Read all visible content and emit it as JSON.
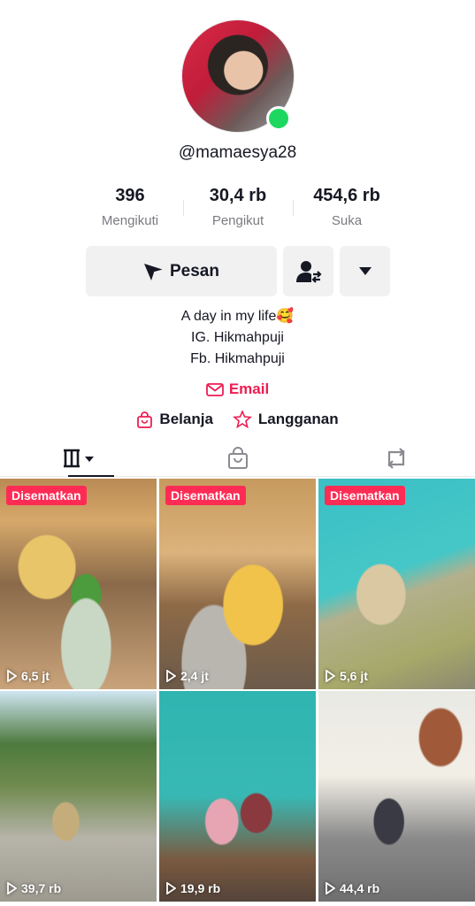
{
  "profile": {
    "username": "@mamaesya28",
    "online_color": "#1ed760"
  },
  "stats": [
    {
      "value": "396",
      "label": "Mengikuti"
    },
    {
      "value": "30,4 rb",
      "label": "Pengikut"
    },
    {
      "value": "454,6 rb",
      "label": "Suka"
    }
  ],
  "actions": {
    "message_label": "Pesan",
    "add_friend_icon": "add-friend-icon",
    "more_icon": "triangle-down-icon"
  },
  "bio": {
    "line1": "A day in my life🥰",
    "line2": "IG. Hikmahpuji",
    "line3": "Fb. Hikmahpuji"
  },
  "links": {
    "email": "Email",
    "shop": "Belanja",
    "subscription": "Langganan"
  },
  "tabs": [
    "videos-tab",
    "liked-locked-tab",
    "reposts-tab"
  ],
  "accent_color": "#fe2c55",
  "videos": [
    {
      "pinned": "Disematkan",
      "views": "6,5 jt"
    },
    {
      "pinned": "Disematkan",
      "views": "2,4 jt"
    },
    {
      "pinned": "Disematkan",
      "views": "5,6 jt"
    },
    {
      "pinned": "",
      "views": "39,7 rb"
    },
    {
      "pinned": "",
      "views": "19,9 rb"
    },
    {
      "pinned": "",
      "views": "44,4 rb"
    }
  ]
}
